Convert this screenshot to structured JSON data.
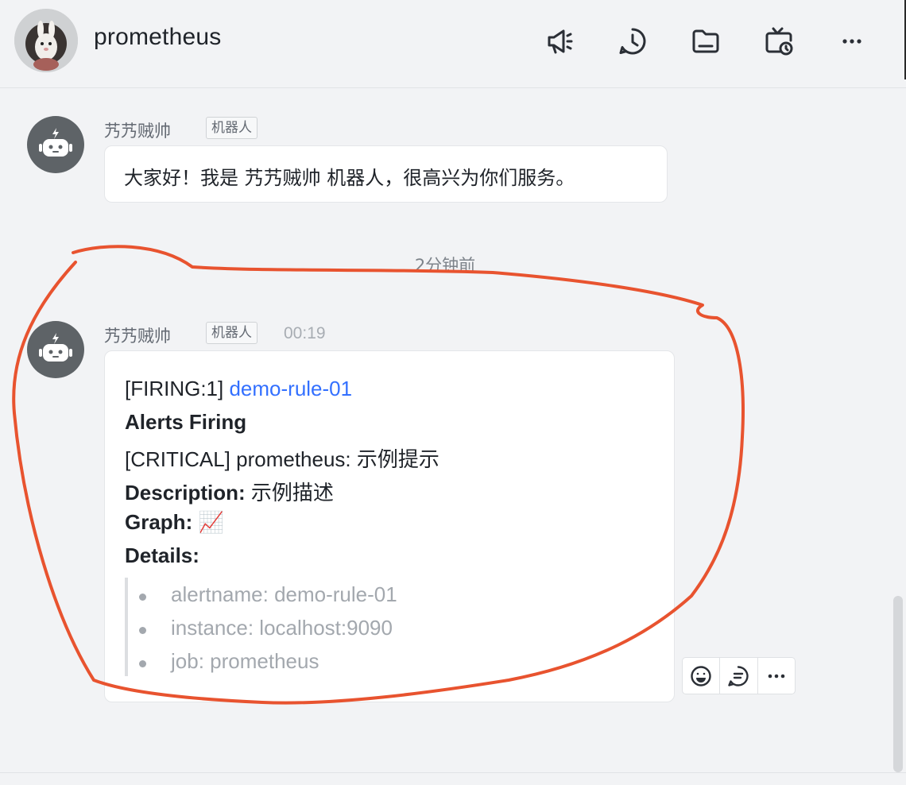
{
  "header": {
    "title": "prometheus",
    "actions": [
      "announcement-icon",
      "history-icon",
      "folder-icon",
      "scheduled-icon",
      "more-icon"
    ]
  },
  "messages": [
    {
      "sender": "艿艿贼帅",
      "tag": "机器人",
      "text": "大家好！我是 艿艿贼帅 机器人，很高兴为你们服务。"
    },
    {
      "sender": "艿艿贼帅",
      "tag": "机器人",
      "time": "00:19",
      "firing_prefix": "[FIRING:1] ",
      "firing_link": "demo-rule-01",
      "alerts_heading": "Alerts Firing",
      "critical_line": "[CRITICAL] prometheus: 示例提示",
      "description_label": "Description:",
      "description_value": " 示例描述",
      "graph_label": "Graph:",
      "graph_icon": "📈",
      "details_label": "Details:",
      "details": [
        "alertname: demo-rule-01",
        "instance: localhost:9090",
        "job: prometheus"
      ]
    }
  ],
  "separator_time": "2分钟前",
  "annotation_color": "#e8532f",
  "message_actions": [
    "emoji-icon",
    "reply-icon",
    "more-icon"
  ]
}
